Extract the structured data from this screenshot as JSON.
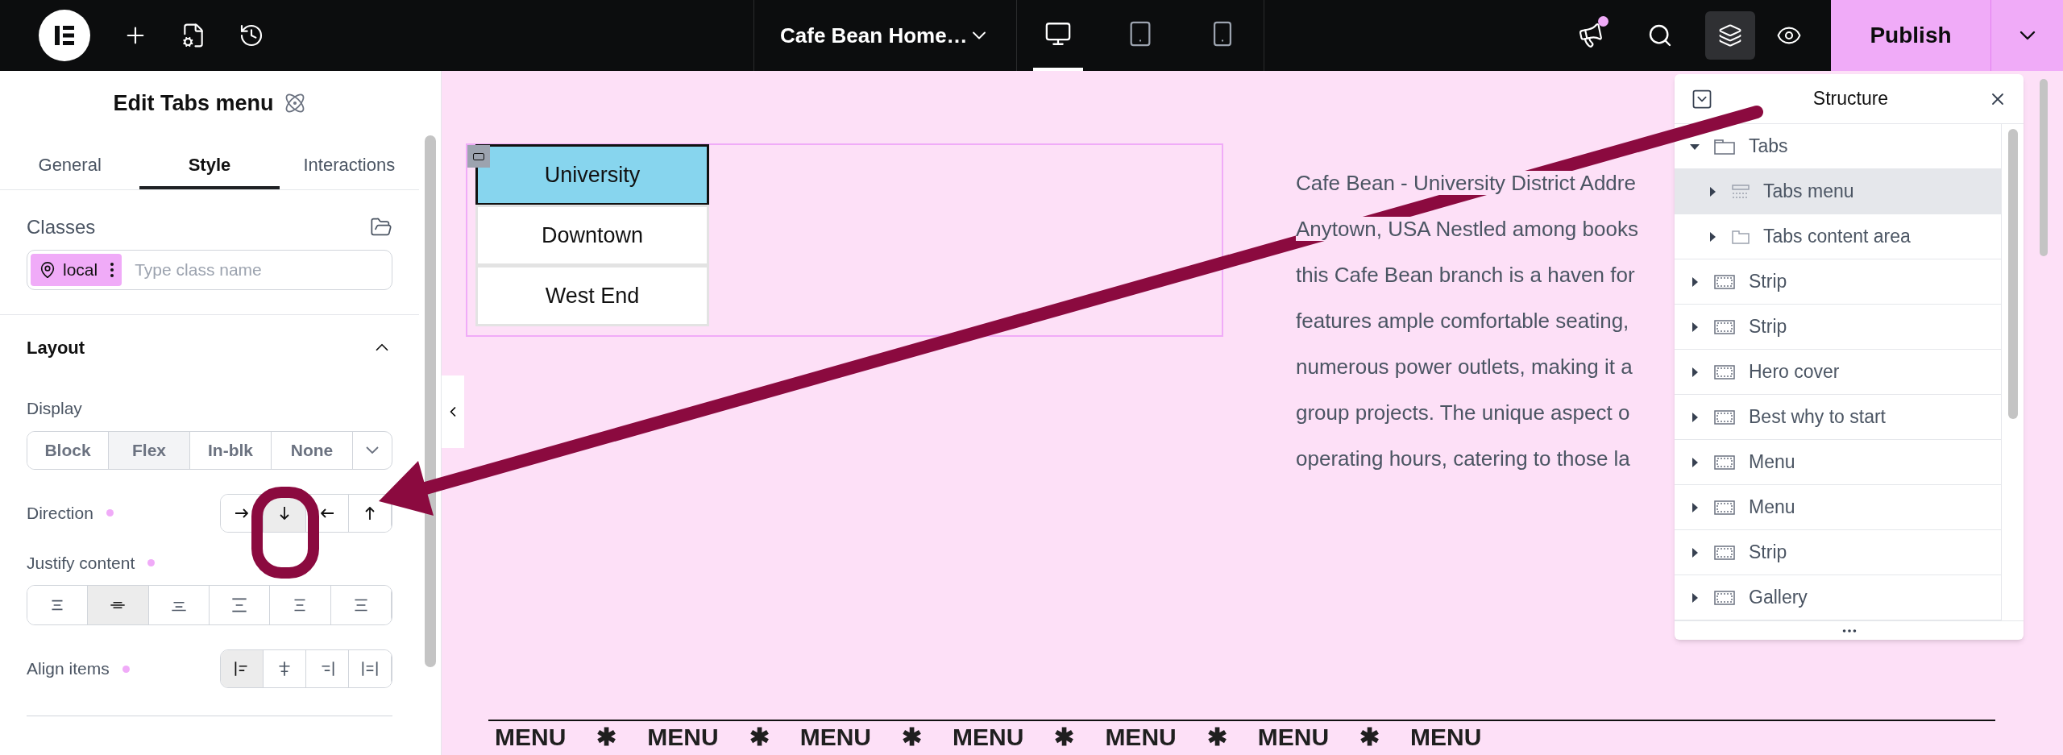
{
  "top_bar": {
    "page_title": "Cafe Bean Home…",
    "devices": [
      {
        "kind": "desktop",
        "selected": true
      },
      {
        "kind": "tablet",
        "selected": false
      },
      {
        "kind": "mobile",
        "selected": false
      }
    ],
    "notifications": {
      "unread": true
    },
    "structure_toggle": {
      "on": true
    },
    "publish": "Publish"
  },
  "panel": {
    "title": "Edit Tabs menu",
    "tabs": [
      {
        "label": "General",
        "selected": false
      },
      {
        "label": "Style",
        "selected": true
      },
      {
        "label": "Interactions",
        "selected": false
      }
    ],
    "classes": {
      "label": "Classes",
      "chip": "local",
      "placeholder": "Type class name"
    },
    "section": {
      "title": "Layout",
      "expanded": true
    },
    "display": {
      "label": "Display",
      "options": [
        {
          "label": "Block",
          "selected": false
        },
        {
          "label": "Flex",
          "selected": true
        },
        {
          "label": "In-blk",
          "selected": false
        },
        {
          "label": "None",
          "selected": false
        }
      ]
    },
    "direction": {
      "label": "Direction",
      "modified": true,
      "options": [
        {
          "kind": "right",
          "selected": false
        },
        {
          "kind": "down",
          "selected": true
        },
        {
          "kind": "left",
          "selected": false
        },
        {
          "kind": "up",
          "selected": false
        }
      ]
    },
    "justify": {
      "label": "Justify content",
      "modified": true,
      "options": [
        {
          "kind": "start",
          "selected": false
        },
        {
          "kind": "center",
          "selected": true
        },
        {
          "kind": "end",
          "selected": false
        },
        {
          "kind": "between",
          "selected": false
        },
        {
          "kind": "around",
          "selected": false
        },
        {
          "kind": "evenly",
          "selected": false
        }
      ]
    },
    "align": {
      "label": "Align items",
      "modified": true,
      "options": [
        {
          "kind": "start",
          "selected": true
        },
        {
          "kind": "center",
          "selected": false
        },
        {
          "kind": "end",
          "selected": false
        },
        {
          "kind": "stretch",
          "selected": false
        }
      ]
    }
  },
  "canvas": {
    "tabs": [
      {
        "label": "University",
        "selected": true
      },
      {
        "label": "Downtown",
        "selected": false
      },
      {
        "label": "West End",
        "selected": false
      }
    ],
    "paragraph_lines": [
      "Cafe Bean - University District Addre",
      "Anytown, USA Nestled among books",
      "this Cafe Bean branch is a haven for",
      "features ample comfortable seating,",
      "numerous power outlets, making it a",
      "group projects. The unique aspect o",
      "operating hours, catering to those la"
    ],
    "marquee": [
      "MENU",
      "✱",
      "MENU",
      "✱",
      "MENU",
      "✱",
      "MENU",
      "✱",
      "MENU",
      "✱",
      "MENU",
      "✱",
      "MENU"
    ]
  },
  "structure": {
    "title": "Structure",
    "items": [
      {
        "label": "Tabs",
        "kind": "tabs",
        "selected": false,
        "expanded": true,
        "children": [
          {
            "label": "Tabs menu",
            "kind": "menu",
            "selected": true,
            "expanded": false
          },
          {
            "label": "Tabs content area",
            "kind": "content",
            "selected": false,
            "expanded": false
          }
        ]
      },
      {
        "label": "Strip",
        "kind": "section",
        "selected": false,
        "expanded": false
      },
      {
        "label": "Strip",
        "kind": "section",
        "selected": false,
        "expanded": false
      },
      {
        "label": "Hero cover",
        "kind": "section",
        "selected": false,
        "expanded": false
      },
      {
        "label": "Best why to start",
        "kind": "section",
        "selected": false,
        "expanded": false
      },
      {
        "label": "Menu",
        "kind": "section",
        "selected": false,
        "expanded": false
      },
      {
        "label": "Menu",
        "kind": "section",
        "selected": false,
        "expanded": false
      },
      {
        "label": "Strip",
        "kind": "section",
        "selected": false,
        "expanded": false
      },
      {
        "label": "Gallery",
        "kind": "section",
        "selected": false,
        "expanded": false
      }
    ]
  }
}
